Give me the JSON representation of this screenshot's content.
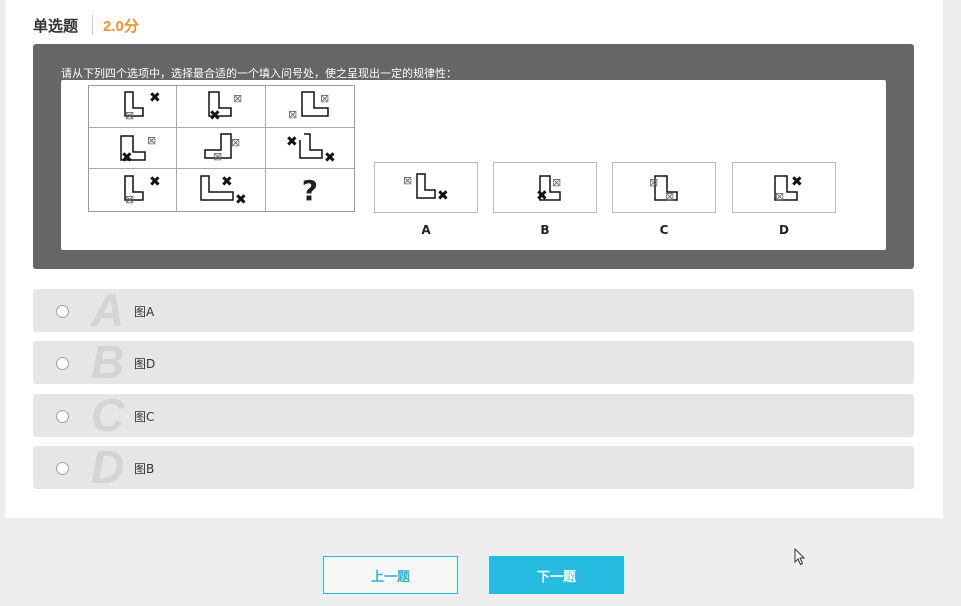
{
  "question": {
    "type_label": "单选题",
    "score": "2.0分",
    "stem": "请从下列四个选项中，选择最合适的一个填入问号处，使之呈现出一定的规律性：",
    "question_mark": "?",
    "choice_labels": [
      "A",
      "B",
      "C",
      "D"
    ]
  },
  "options": [
    {
      "letter": "A",
      "text": "图A"
    },
    {
      "letter": "B",
      "text": "图D"
    },
    {
      "letter": "C",
      "text": "图C"
    },
    {
      "letter": "D",
      "text": "图B"
    }
  ],
  "buttons": {
    "prev": "上一题",
    "next": "下一题"
  },
  "colors": {
    "accent": "#26bbe0",
    "score": "#f0912a",
    "stem_bg": "#666666",
    "option_bg": "#e6e6e6"
  }
}
